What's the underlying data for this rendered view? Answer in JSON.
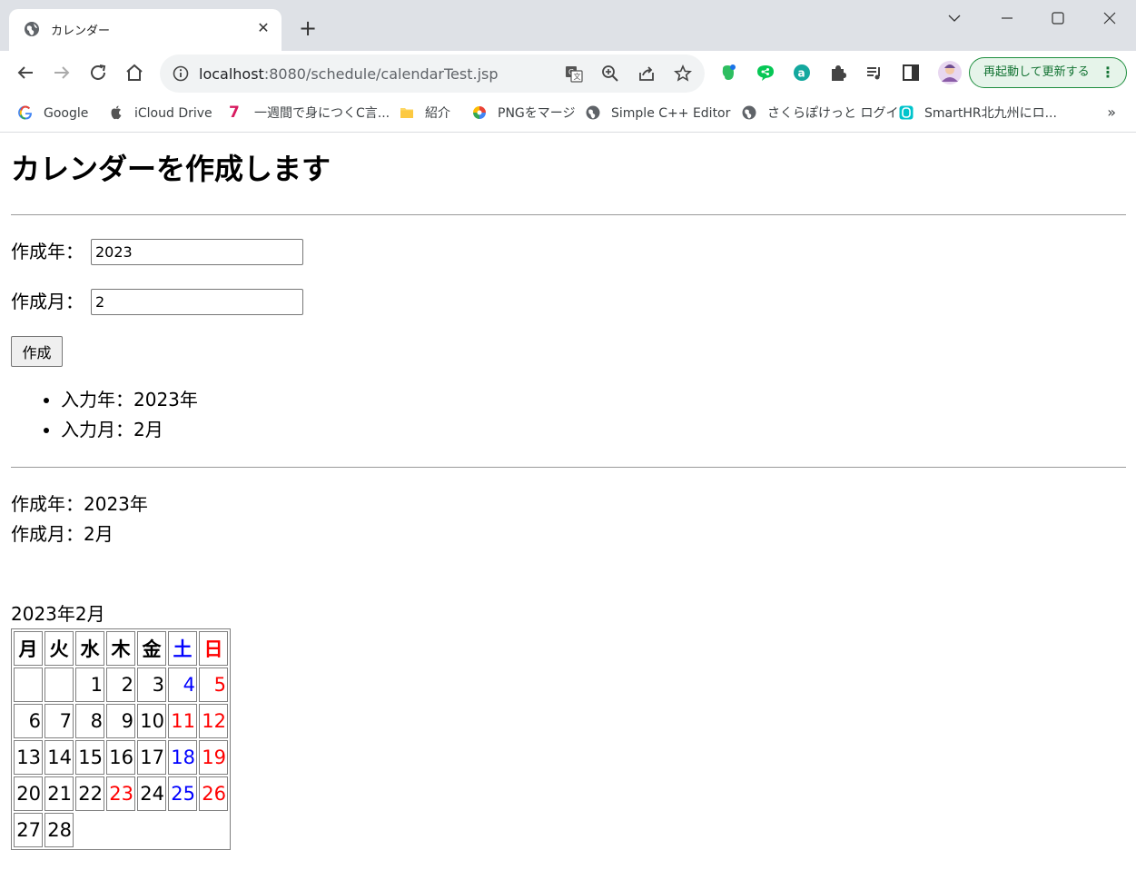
{
  "browser": {
    "tab_title": "カレンダー",
    "url_host": "localhost",
    "url_rest": ":8080/schedule/calendarTest.jsp",
    "relaunch_label": "再起動して更新する",
    "bookmarks": [
      {
        "label": "Google",
        "icon": "google-icon"
      },
      {
        "label": "iCloud Drive",
        "icon": "apple-icon"
      },
      {
        "label": "一週間で身につくC言...",
        "icon": "seven-icon"
      },
      {
        "label": "紹介",
        "icon": "folder-icon"
      },
      {
        "label": "PNGをマージ",
        "icon": "pinwheel-icon"
      },
      {
        "label": "Simple C++ Editor",
        "icon": "globe-icon"
      },
      {
        "label": "さくらぽけっと ログイン",
        "icon": "globe-icon"
      },
      {
        "label": "SmartHR北九州にロ...",
        "icon": "smarthr-icon"
      }
    ],
    "more_bookmarks": "»"
  },
  "page": {
    "heading": "カレンダーを作成します",
    "year_label": "作成年：",
    "year_value": "2023",
    "month_label": "作成月：",
    "month_value": "2",
    "submit_label": "作成",
    "input_summary": [
      "入力年：2023年",
      "入力月：2月"
    ],
    "created_year": "作成年：2023年",
    "created_month": "作成月：2月",
    "calendar_caption": "2023年2月"
  },
  "calendar": {
    "weekdays": [
      "月",
      "火",
      "水",
      "木",
      "金",
      "土",
      "日"
    ],
    "weekday_colors": [
      "",
      "",
      "",
      "",
      "",
      "blue",
      "red"
    ],
    "weeks": [
      [
        null,
        null,
        {
          "d": "1"
        },
        {
          "d": "2"
        },
        {
          "d": "3"
        },
        {
          "d": "4",
          "c": "blue"
        },
        {
          "d": "5",
          "c": "red"
        }
      ],
      [
        {
          "d": "6"
        },
        {
          "d": "7"
        },
        {
          "d": "8"
        },
        {
          "d": "9"
        },
        {
          "d": "10"
        },
        {
          "d": "11",
          "c": "red"
        },
        {
          "d": "12",
          "c": "red"
        }
      ],
      [
        {
          "d": "13"
        },
        {
          "d": "14"
        },
        {
          "d": "15"
        },
        {
          "d": "16"
        },
        {
          "d": "17"
        },
        {
          "d": "18",
          "c": "blue"
        },
        {
          "d": "19",
          "c": "red"
        }
      ],
      [
        {
          "d": "20"
        },
        {
          "d": "21"
        },
        {
          "d": "22"
        },
        {
          "d": "23",
          "c": "red"
        },
        {
          "d": "24"
        },
        {
          "d": "25",
          "c": "blue"
        },
        {
          "d": "26",
          "c": "red"
        }
      ],
      [
        {
          "d": "27"
        },
        {
          "d": "28"
        }
      ]
    ],
    "colors": {
      "blue": "#0000ff",
      "red": "#ff0000"
    }
  }
}
